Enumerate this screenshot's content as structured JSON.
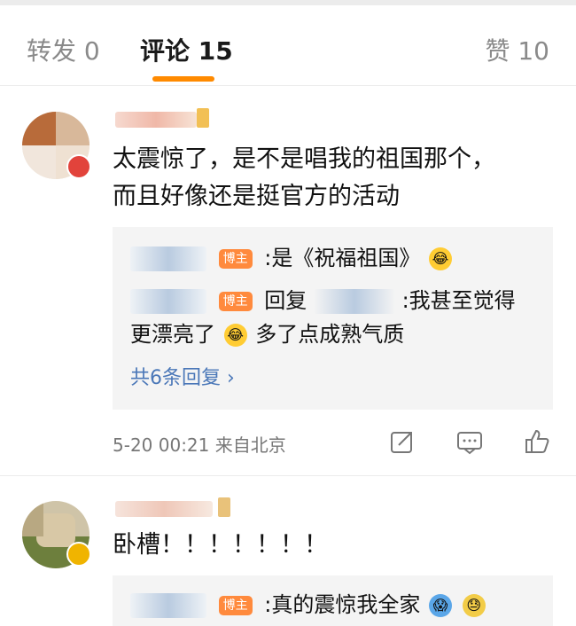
{
  "tabs": {
    "repost": "转发 0",
    "comments": "评论 15",
    "likes": "赞 10"
  },
  "comments": [
    {
      "text_line1": "太震惊了，是不是唱我的祖国那个，",
      "text_line2": "而且好像还是挺官方的活动",
      "replies": [
        {
          "tag": "博主",
          "text": ":是《祝福祖国》"
        },
        {
          "tag": "博主",
          "prefix": "回复",
          "text": ":我甚至觉得",
          "text2": "更漂亮了",
          "text3": "多了点成熟气质"
        }
      ],
      "more_replies": "共6条回复 ›",
      "meta": "5-20 00:21  来自北京"
    },
    {
      "text": "卧槽！！！！！！！",
      "replies": [
        {
          "tag": "博主",
          "text": ":真的震惊我全家"
        }
      ]
    }
  ],
  "icons": [
    "share-icon",
    "comment-icon",
    "like-icon"
  ],
  "colors": {
    "accent": "#ff8a00",
    "link": "#4a77b8",
    "tag": "#ff8a3d"
  }
}
